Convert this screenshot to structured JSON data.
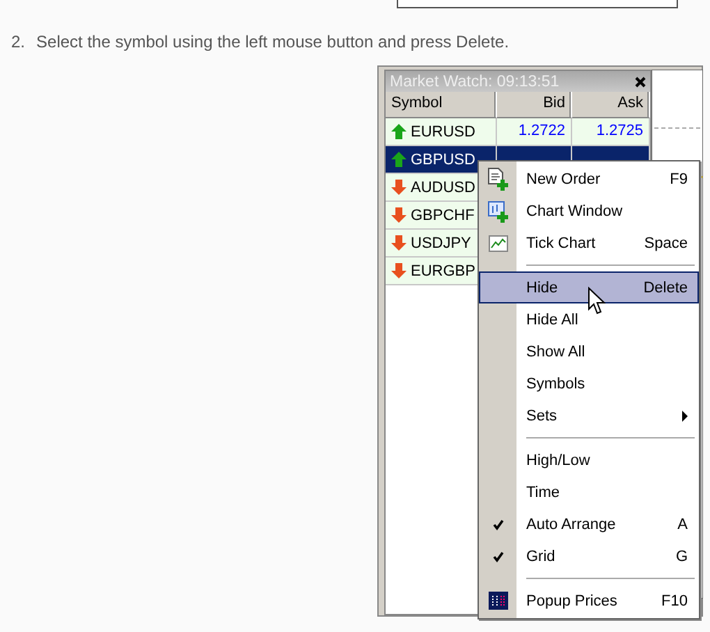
{
  "instruction": {
    "number": "2.",
    "text": "Select the symbol using the left mouse button and press Delete."
  },
  "market_watch": {
    "title": "Market Watch: 09:13:51",
    "columns": [
      "Symbol",
      "Bid",
      "Ask"
    ],
    "rows": [
      {
        "kind": "up",
        "symbol": "EURUSD",
        "bid": "1.2722",
        "ask": "1.2725",
        "selected": false
      },
      {
        "kind": "up",
        "symbol": "GBPUSD",
        "selected": true
      },
      {
        "kind": "down",
        "symbol": "AUDUSD",
        "selected": false
      },
      {
        "kind": "down",
        "symbol": "GBPCHF",
        "selected": false
      },
      {
        "kind": "down",
        "symbol": "USDJPY",
        "selected": false
      },
      {
        "kind": "down",
        "symbol": "EURGBP",
        "selected": false
      }
    ]
  },
  "context_menu": {
    "items": [
      {
        "kind": "new-order",
        "label": "New Order",
        "shortcut": "F9",
        "checked": false,
        "selected": false
      },
      {
        "kind": "chart-window",
        "label": "Chart Window",
        "checked": false,
        "selected": false
      },
      {
        "kind": "tick-chart",
        "label": "Tick Chart",
        "shortcut": "Space",
        "checked": false,
        "selected": false
      },
      {
        "kind": "separator"
      },
      {
        "kind": "text",
        "label": "Hide",
        "shortcut": "Delete",
        "checked": false,
        "selected": true
      },
      {
        "kind": "text",
        "label": "Hide All",
        "checked": false,
        "selected": false
      },
      {
        "kind": "text",
        "label": "Show All",
        "checked": false,
        "selected": false
      },
      {
        "kind": "text",
        "label": "Symbols",
        "checked": false,
        "selected": false
      },
      {
        "kind": "submenu",
        "label": "Sets",
        "checked": false,
        "selected": false
      },
      {
        "kind": "separator"
      },
      {
        "kind": "text",
        "label": "High/Low",
        "checked": false,
        "selected": false
      },
      {
        "kind": "text",
        "label": "Time",
        "checked": false,
        "selected": false
      },
      {
        "kind": "text",
        "label": "Auto Arrange",
        "shortcut": "A",
        "checked": true,
        "selected": false
      },
      {
        "kind": "text",
        "label": "Grid",
        "shortcut": "G",
        "checked": true,
        "selected": false
      },
      {
        "kind": "separator"
      },
      {
        "kind": "popup-prices",
        "label": "Popup Prices",
        "shortcut": "F10",
        "checked": false,
        "selected": false
      }
    ]
  }
}
